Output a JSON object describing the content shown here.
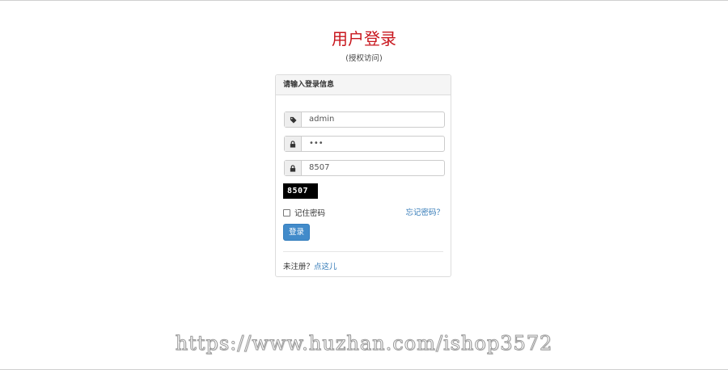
{
  "header": {
    "title": "用户登录",
    "subtitle": "(授权访问)"
  },
  "panel": {
    "heading": "请输入登录信息",
    "username": {
      "value": "admin",
      "icon": "tag-icon"
    },
    "password": {
      "value": "•••",
      "icon": "lock-icon"
    },
    "captcha_input": {
      "value": "8507",
      "icon": "lock-icon"
    },
    "captcha_image_text": "8507",
    "remember_label": "记住密码",
    "remember_checked": false,
    "forgot_link": "忘记密码？",
    "login_button": "登录",
    "register_prompt": "未注册？",
    "register_link": "点这儿"
  },
  "watermark": "https://www.huzhan.com/ishop3572",
  "colors": {
    "title": "#c8161d",
    "primary_button": "#428bca",
    "link": "#337ab7"
  }
}
